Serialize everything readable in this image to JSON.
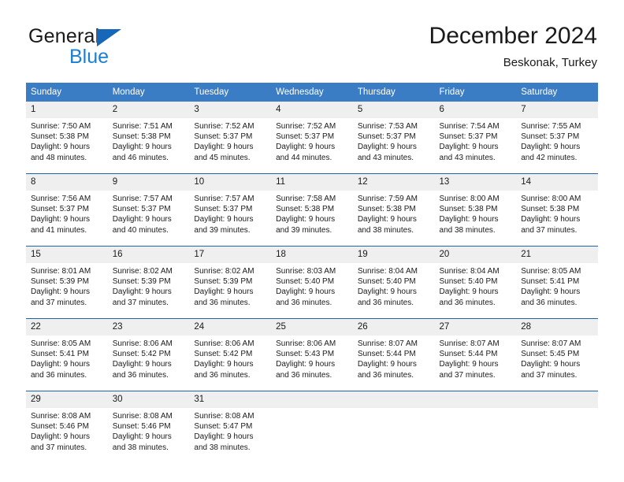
{
  "brand": {
    "word_one": "General",
    "word_two": "Blue",
    "triangle_icon": "triangle-logo-icon",
    "accent_dark": "#1666ba",
    "accent_light": "#1a7fd4"
  },
  "header": {
    "title": "December 2024",
    "subtitle": "Beskonak, Turkey"
  },
  "theme": {
    "header_bg": "#3b7dc4",
    "week_rule": "#1f63a8",
    "day_band_bg": "#efefef"
  },
  "weekdays": [
    "Sunday",
    "Monday",
    "Tuesday",
    "Wednesday",
    "Thursday",
    "Friday",
    "Saturday"
  ],
  "weeks": [
    {
      "days": [
        {
          "date": "1",
          "sunrise": "Sunrise: 7:50 AM",
          "sunset": "Sunset: 5:38 PM",
          "daylight_1": "Daylight: 9 hours",
          "daylight_2": "and 48 minutes."
        },
        {
          "date": "2",
          "sunrise": "Sunrise: 7:51 AM",
          "sunset": "Sunset: 5:38 PM",
          "daylight_1": "Daylight: 9 hours",
          "daylight_2": "and 46 minutes."
        },
        {
          "date": "3",
          "sunrise": "Sunrise: 7:52 AM",
          "sunset": "Sunset: 5:37 PM",
          "daylight_1": "Daylight: 9 hours",
          "daylight_2": "and 45 minutes."
        },
        {
          "date": "4",
          "sunrise": "Sunrise: 7:52 AM",
          "sunset": "Sunset: 5:37 PM",
          "daylight_1": "Daylight: 9 hours",
          "daylight_2": "and 44 minutes."
        },
        {
          "date": "5",
          "sunrise": "Sunrise: 7:53 AM",
          "sunset": "Sunset: 5:37 PM",
          "daylight_1": "Daylight: 9 hours",
          "daylight_2": "and 43 minutes."
        },
        {
          "date": "6",
          "sunrise": "Sunrise: 7:54 AM",
          "sunset": "Sunset: 5:37 PM",
          "daylight_1": "Daylight: 9 hours",
          "daylight_2": "and 43 minutes."
        },
        {
          "date": "7",
          "sunrise": "Sunrise: 7:55 AM",
          "sunset": "Sunset: 5:37 PM",
          "daylight_1": "Daylight: 9 hours",
          "daylight_2": "and 42 minutes."
        }
      ]
    },
    {
      "days": [
        {
          "date": "8",
          "sunrise": "Sunrise: 7:56 AM",
          "sunset": "Sunset: 5:37 PM",
          "daylight_1": "Daylight: 9 hours",
          "daylight_2": "and 41 minutes."
        },
        {
          "date": "9",
          "sunrise": "Sunrise: 7:57 AM",
          "sunset": "Sunset: 5:37 PM",
          "daylight_1": "Daylight: 9 hours",
          "daylight_2": "and 40 minutes."
        },
        {
          "date": "10",
          "sunrise": "Sunrise: 7:57 AM",
          "sunset": "Sunset: 5:37 PM",
          "daylight_1": "Daylight: 9 hours",
          "daylight_2": "and 39 minutes."
        },
        {
          "date": "11",
          "sunrise": "Sunrise: 7:58 AM",
          "sunset": "Sunset: 5:38 PM",
          "daylight_1": "Daylight: 9 hours",
          "daylight_2": "and 39 minutes."
        },
        {
          "date": "12",
          "sunrise": "Sunrise: 7:59 AM",
          "sunset": "Sunset: 5:38 PM",
          "daylight_1": "Daylight: 9 hours",
          "daylight_2": "and 38 minutes."
        },
        {
          "date": "13",
          "sunrise": "Sunrise: 8:00 AM",
          "sunset": "Sunset: 5:38 PM",
          "daylight_1": "Daylight: 9 hours",
          "daylight_2": "and 38 minutes."
        },
        {
          "date": "14",
          "sunrise": "Sunrise: 8:00 AM",
          "sunset": "Sunset: 5:38 PM",
          "daylight_1": "Daylight: 9 hours",
          "daylight_2": "and 37 minutes."
        }
      ]
    },
    {
      "days": [
        {
          "date": "15",
          "sunrise": "Sunrise: 8:01 AM",
          "sunset": "Sunset: 5:39 PM",
          "daylight_1": "Daylight: 9 hours",
          "daylight_2": "and 37 minutes."
        },
        {
          "date": "16",
          "sunrise": "Sunrise: 8:02 AM",
          "sunset": "Sunset: 5:39 PM",
          "daylight_1": "Daylight: 9 hours",
          "daylight_2": "and 37 minutes."
        },
        {
          "date": "17",
          "sunrise": "Sunrise: 8:02 AM",
          "sunset": "Sunset: 5:39 PM",
          "daylight_1": "Daylight: 9 hours",
          "daylight_2": "and 36 minutes."
        },
        {
          "date": "18",
          "sunrise": "Sunrise: 8:03 AM",
          "sunset": "Sunset: 5:40 PM",
          "daylight_1": "Daylight: 9 hours",
          "daylight_2": "and 36 minutes."
        },
        {
          "date": "19",
          "sunrise": "Sunrise: 8:04 AM",
          "sunset": "Sunset: 5:40 PM",
          "daylight_1": "Daylight: 9 hours",
          "daylight_2": "and 36 minutes."
        },
        {
          "date": "20",
          "sunrise": "Sunrise: 8:04 AM",
          "sunset": "Sunset: 5:40 PM",
          "daylight_1": "Daylight: 9 hours",
          "daylight_2": "and 36 minutes."
        },
        {
          "date": "21",
          "sunrise": "Sunrise: 8:05 AM",
          "sunset": "Sunset: 5:41 PM",
          "daylight_1": "Daylight: 9 hours",
          "daylight_2": "and 36 minutes."
        }
      ]
    },
    {
      "days": [
        {
          "date": "22",
          "sunrise": "Sunrise: 8:05 AM",
          "sunset": "Sunset: 5:41 PM",
          "daylight_1": "Daylight: 9 hours",
          "daylight_2": "and 36 minutes."
        },
        {
          "date": "23",
          "sunrise": "Sunrise: 8:06 AM",
          "sunset": "Sunset: 5:42 PM",
          "daylight_1": "Daylight: 9 hours",
          "daylight_2": "and 36 minutes."
        },
        {
          "date": "24",
          "sunrise": "Sunrise: 8:06 AM",
          "sunset": "Sunset: 5:42 PM",
          "daylight_1": "Daylight: 9 hours",
          "daylight_2": "and 36 minutes."
        },
        {
          "date": "25",
          "sunrise": "Sunrise: 8:06 AM",
          "sunset": "Sunset: 5:43 PM",
          "daylight_1": "Daylight: 9 hours",
          "daylight_2": "and 36 minutes."
        },
        {
          "date": "26",
          "sunrise": "Sunrise: 8:07 AM",
          "sunset": "Sunset: 5:44 PM",
          "daylight_1": "Daylight: 9 hours",
          "daylight_2": "and 36 minutes."
        },
        {
          "date": "27",
          "sunrise": "Sunrise: 8:07 AM",
          "sunset": "Sunset: 5:44 PM",
          "daylight_1": "Daylight: 9 hours",
          "daylight_2": "and 37 minutes."
        },
        {
          "date": "28",
          "sunrise": "Sunrise: 8:07 AM",
          "sunset": "Sunset: 5:45 PM",
          "daylight_1": "Daylight: 9 hours",
          "daylight_2": "and 37 minutes."
        }
      ]
    },
    {
      "days": [
        {
          "date": "29",
          "sunrise": "Sunrise: 8:08 AM",
          "sunset": "Sunset: 5:46 PM",
          "daylight_1": "Daylight: 9 hours",
          "daylight_2": "and 37 minutes."
        },
        {
          "date": "30",
          "sunrise": "Sunrise: 8:08 AM",
          "sunset": "Sunset: 5:46 PM",
          "daylight_1": "Daylight: 9 hours",
          "daylight_2": "and 38 minutes."
        },
        {
          "date": "31",
          "sunrise": "Sunrise: 8:08 AM",
          "sunset": "Sunset: 5:47 PM",
          "daylight_1": "Daylight: 9 hours",
          "daylight_2": "and 38 minutes."
        },
        {
          "date": "",
          "sunrise": "",
          "sunset": "",
          "daylight_1": "",
          "daylight_2": ""
        },
        {
          "date": "",
          "sunrise": "",
          "sunset": "",
          "daylight_1": "",
          "daylight_2": ""
        },
        {
          "date": "",
          "sunrise": "",
          "sunset": "",
          "daylight_1": "",
          "daylight_2": ""
        },
        {
          "date": "",
          "sunrise": "",
          "sunset": "",
          "daylight_1": "",
          "daylight_2": ""
        }
      ]
    }
  ]
}
